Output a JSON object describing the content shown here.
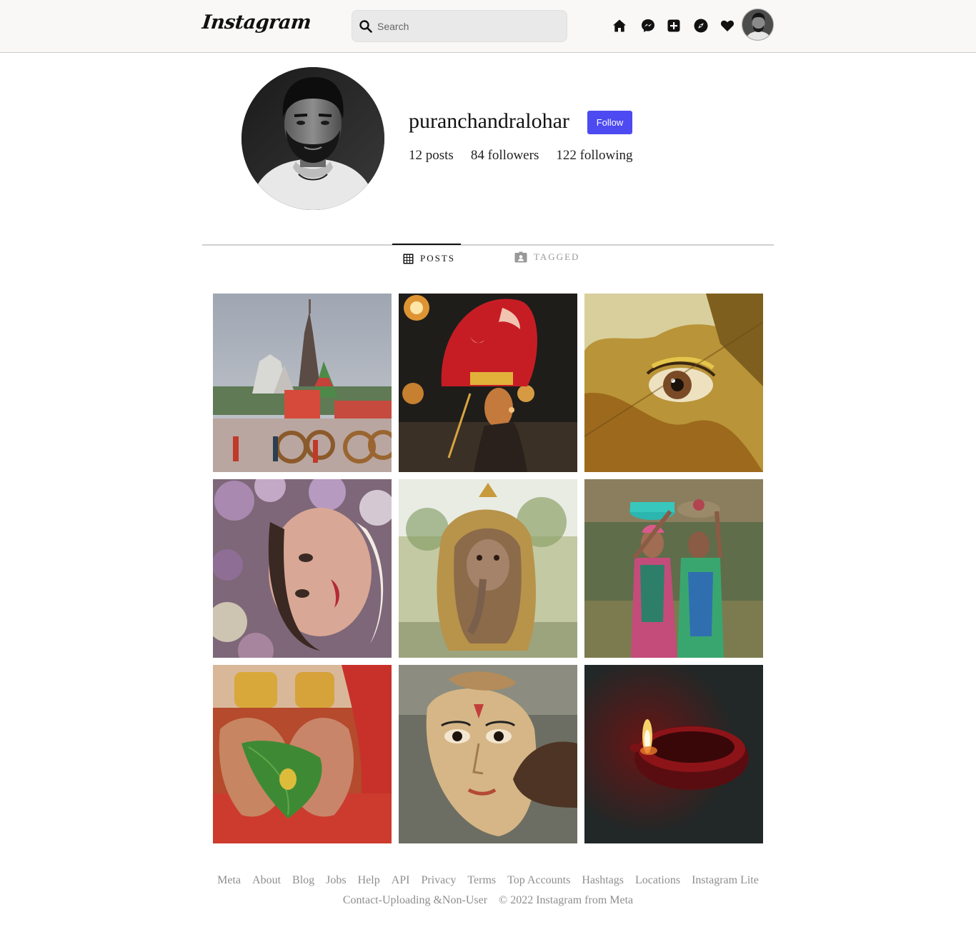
{
  "header": {
    "logo_text": "Instagram",
    "search": {
      "placeholder": "Search"
    }
  },
  "profile": {
    "username": "puranchandralohar",
    "follow_label": "Follow",
    "stats": {
      "posts": "12 posts",
      "followers": "84 followers",
      "following": "122 following"
    }
  },
  "tabs": [
    {
      "label": "POSTS",
      "icon": "grid-icon",
      "active": true
    },
    {
      "label": "TAGGED",
      "icon": "tagged-icon",
      "active": false
    }
  ],
  "posts": [
    {
      "subject": "temple-chariots"
    },
    {
      "subject": "theyyam-performer"
    },
    {
      "subject": "eye-through-leaf"
    },
    {
      "subject": "woman-in-flowers"
    },
    {
      "subject": "ganesha-idol"
    },
    {
      "subject": "women-carrying-baskets"
    },
    {
      "subject": "mehndi-hands-leaf"
    },
    {
      "subject": "durga-idol-painting"
    },
    {
      "subject": "diya-lamp"
    }
  ],
  "footer": {
    "links": [
      "Meta",
      "About",
      "Blog",
      "Jobs",
      "Help",
      "API",
      "Privacy",
      "Terms",
      "Top Accounts",
      "Hashtags",
      "Locations",
      "Instagram Lite"
    ],
    "contact": "Contact-Uploading &Non-User",
    "copyright": "© 2022 Instagram from Meta"
  },
  "colors": {
    "follow_button": "#4d4af2",
    "header_bg": "#f9f8f7",
    "muted_text": "#8e8e8e"
  }
}
